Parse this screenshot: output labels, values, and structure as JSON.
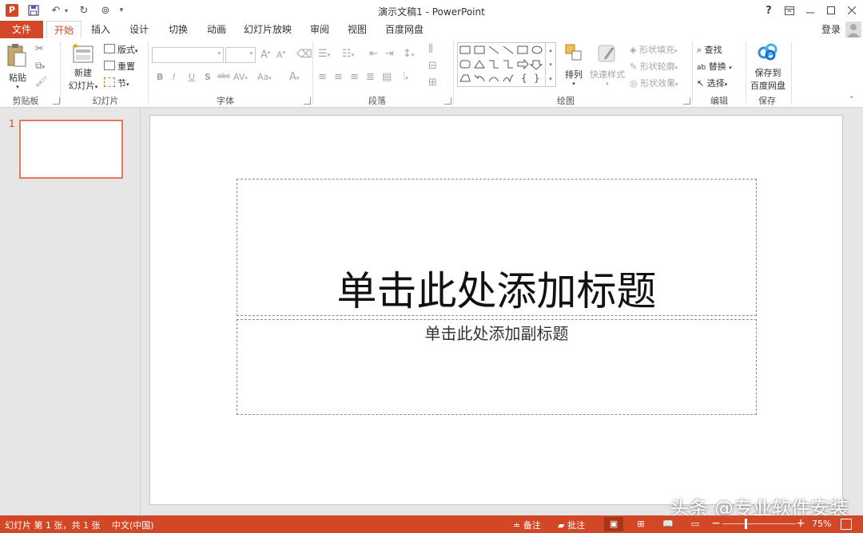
{
  "window": {
    "title": "演示文稿1 - PowerPoint",
    "help": "?",
    "signin": "登录"
  },
  "tabs": [
    "文件",
    "开始",
    "插入",
    "设计",
    "切换",
    "动画",
    "幻灯片放映",
    "审阅",
    "视图",
    "百度网盘"
  ],
  "ribbon": {
    "clipboard": {
      "paste": "粘贴",
      "group": "剪贴板"
    },
    "slides": {
      "new_slide_1": "新建",
      "new_slide_2": "幻灯片",
      "layout": "版式",
      "reset": "重置",
      "section": "节",
      "group": "幻灯片"
    },
    "font": {
      "group": "字体",
      "bold": "B",
      "italic": "I",
      "underline": "U",
      "shadow": "S",
      "strike": "abc",
      "spacing": "AV",
      "case": "Aa",
      "color": "A",
      "grow": "A",
      "shrink": "A"
    },
    "paragraph": {
      "group": "段落"
    },
    "drawing": {
      "arrange": "排列",
      "quick_styles": "快速样式",
      "shape_fill": "形状填充",
      "shape_outline": "形状轮廓",
      "shape_effects": "形状效果",
      "group": "绘图"
    },
    "editing": {
      "find": "查找",
      "replace": "替换",
      "select": "选择",
      "group": "编辑"
    },
    "save": {
      "label_1": "保存到",
      "label_2": "百度网盘",
      "group": "保存"
    }
  },
  "slide_panel": {
    "number": "1"
  },
  "slide": {
    "title_placeholder": "单击此处添加标题",
    "subtitle_placeholder": "单击此处添加副标题"
  },
  "status": {
    "slide_info": "幻灯片 第 1 张，共 1 张",
    "language": "中文(中国)",
    "notes": "备注",
    "comments": "批注",
    "zoom": "75%"
  },
  "watermark": "头条 @专业软件安装",
  "colors": {
    "accent": "#d24726",
    "thumb_border": "#e8765a"
  }
}
